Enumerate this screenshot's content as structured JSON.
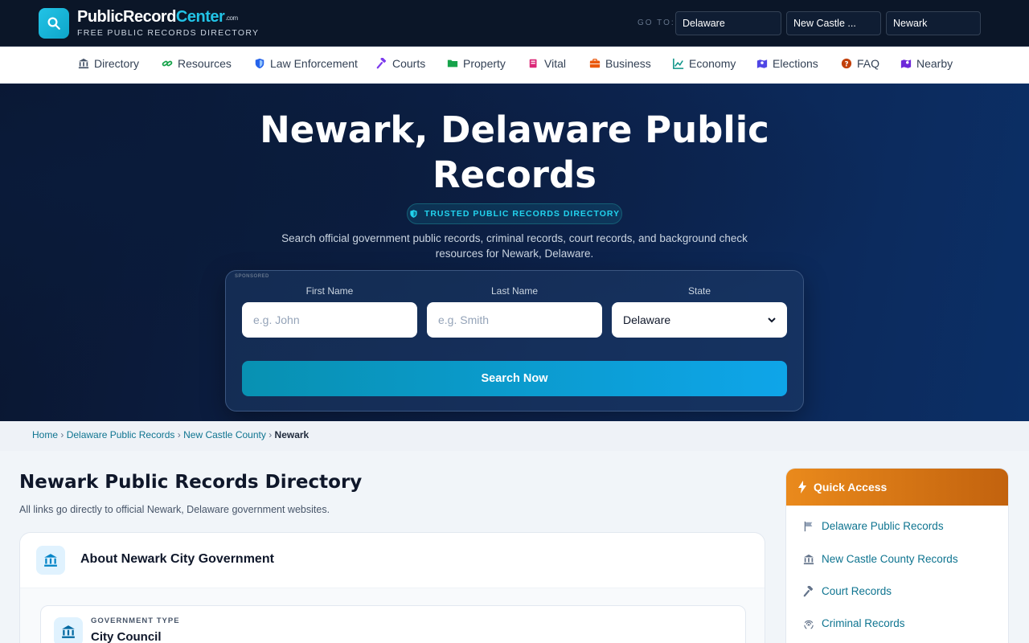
{
  "brand": {
    "name_part1": "PublicRecord",
    "name_part2": "Center",
    "suffix": ".com",
    "tagline": "FREE PUBLIC RECORDS DIRECTORY"
  },
  "goto": {
    "label": "GO TO:",
    "state": "Delaware",
    "county": "New Castle ...",
    "city": "Newark"
  },
  "nav": {
    "items": [
      {
        "label": "Directory",
        "icon": "bank-icon"
      },
      {
        "label": "Resources",
        "icon": "link-icon"
      },
      {
        "label": "Law Enforcement",
        "icon": "shield-icon"
      },
      {
        "label": "Courts",
        "icon": "gavel-icon"
      },
      {
        "label": "Property",
        "icon": "folder-icon"
      },
      {
        "label": "Vital",
        "icon": "certificate-icon"
      },
      {
        "label": "Business",
        "icon": "briefcase-icon"
      },
      {
        "label": "Economy",
        "icon": "chart-line-icon"
      },
      {
        "label": "Elections",
        "icon": "map-marked-icon"
      },
      {
        "label": "FAQ",
        "icon": "question-icon"
      },
      {
        "label": "Nearby",
        "icon": "map-icon"
      }
    ]
  },
  "hero": {
    "title": "Newark, Delaware Public Records",
    "badge": "TRUSTED PUBLIC RECORDS DIRECTORY",
    "subtitle": "Search official government public records, criminal records, court records, and background check resources for Newark, Delaware."
  },
  "search": {
    "sponsored": "SPONSORED",
    "first_name_label": "First Name",
    "first_name_placeholder": "e.g. John",
    "last_name_label": "Last Name",
    "last_name_placeholder": "e.g. Smith",
    "state_label": "State",
    "state_value": "Delaware",
    "button": "Search Now"
  },
  "breadcrumb": {
    "home": "Home",
    "state": "Delaware Public Records",
    "county": "New Castle County",
    "current": "Newark"
  },
  "main": {
    "title": "Newark Public Records Directory",
    "subtitle": "All links go directly to official Newark, Delaware government websites.",
    "about_title": "About Newark City Government",
    "gov_type_label": "GOVERNMENT TYPE",
    "gov_type_value": "City Council"
  },
  "quick_access": {
    "title": "Quick Access",
    "items": [
      {
        "label": "Delaware Public Records",
        "icon": "flag-icon"
      },
      {
        "label": "New Castle County Records",
        "icon": "bank-icon"
      },
      {
        "label": "Court Records",
        "icon": "gavel-icon"
      },
      {
        "label": "Criminal Records",
        "icon": "fingerprint-icon"
      }
    ]
  },
  "colors": {
    "topbar": "#0b1628",
    "accent": "#22c3e6",
    "link": "#0e7490",
    "quick_header": "#ea8a1c"
  }
}
